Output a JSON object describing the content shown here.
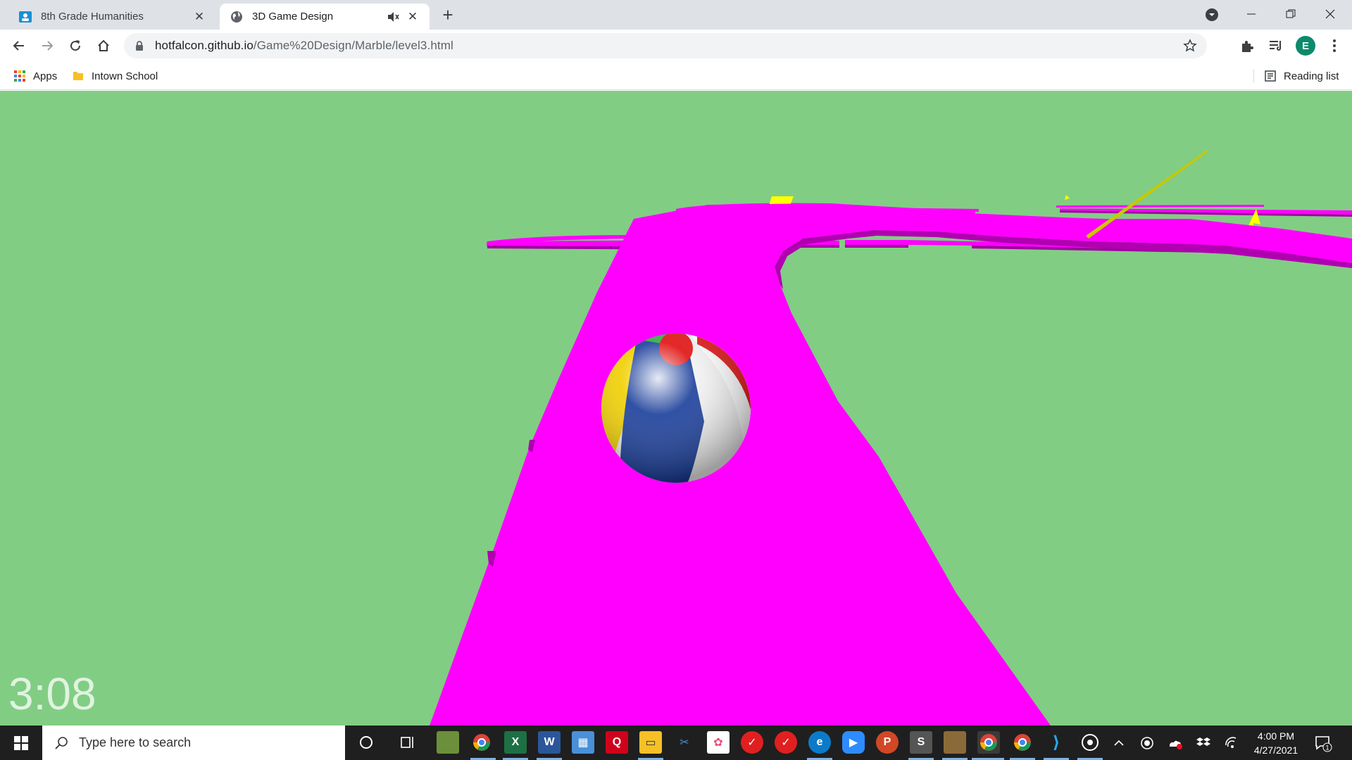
{
  "browser": {
    "tabs": [
      {
        "title": "8th Grade Humanities",
        "icon": "classroom-icon",
        "active": false
      },
      {
        "title": "3D Game Design",
        "icon": "globe-icon",
        "active": true,
        "audio": "muted-speaker-icon"
      }
    ],
    "url_host": "hotfalcon.github.io",
    "url_path": "/Game%20Design/Marble/level3.html",
    "profile_initial": "E",
    "bookmarks": [
      {
        "label": "Apps",
        "icon": "apps-grid-icon"
      },
      {
        "label": "Intown School",
        "icon": "folder-icon"
      }
    ],
    "reading_list": "Reading list"
  },
  "game": {
    "timer": "3:08",
    "colors": {
      "ground": "#82cd84",
      "track": "#ff00ff",
      "track_side": "#b000b0",
      "pickup": "#ffff00"
    }
  },
  "taskbar": {
    "search_placeholder": "Type here to search",
    "time": "4:00 PM",
    "date": "4/27/2021",
    "notification_count": "1"
  }
}
